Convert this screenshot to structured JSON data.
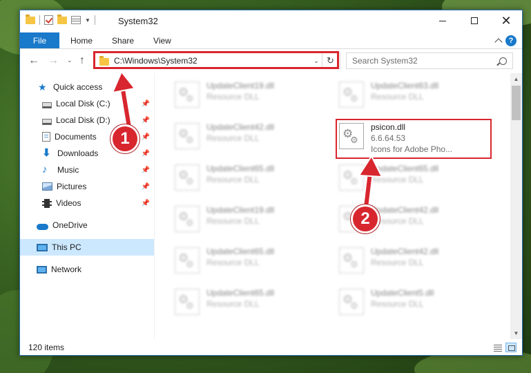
{
  "window": {
    "title": "System32"
  },
  "ribbon": {
    "tabs": [
      "File",
      "Home",
      "Share",
      "View"
    ]
  },
  "address": {
    "path": "C:\\Windows\\System32"
  },
  "search": {
    "placeholder": "Search System32"
  },
  "sidebar": {
    "items": [
      {
        "label": "Quick access",
        "icon": "star-icon",
        "pinned": false
      },
      {
        "label": "Local Disk (C:)",
        "icon": "drive-icon",
        "pinned": true
      },
      {
        "label": "Local Disk (D:)",
        "icon": "drive-icon",
        "pinned": true
      },
      {
        "label": "Documents",
        "icon": "documents-icon",
        "pinned": true
      },
      {
        "label": "Downloads",
        "icon": "download-arrow-icon",
        "pinned": true
      },
      {
        "label": "Music",
        "icon": "music-note-icon",
        "pinned": true
      },
      {
        "label": "Pictures",
        "icon": "picture-icon",
        "pinned": true
      },
      {
        "label": "Videos",
        "icon": "film-icon",
        "pinned": true
      },
      {
        "label": "OneDrive",
        "icon": "cloud-icon",
        "pinned": false
      },
      {
        "label": "This PC",
        "icon": "computer-icon",
        "pinned": false,
        "selected": true
      },
      {
        "label": "Network",
        "icon": "network-icon",
        "pinned": false
      }
    ]
  },
  "files": [
    {
      "name": "UpdateClient19.dll",
      "desc": "Resource DLL",
      "blurred": true
    },
    {
      "name": "UpdateClient63.dll",
      "desc": "Resource DLL",
      "blurred": true
    },
    {
      "name": "UpdateClient42.dll",
      "desc": "Resource DLL",
      "blurred": true
    },
    {
      "name": "psicon.dll",
      "version": "6.6.64.53",
      "desc": "Icons for Adobe Pho...",
      "blurred": false,
      "highlighted": true
    },
    {
      "name": "UpdateClient65.dll",
      "desc": "Resource DLL",
      "blurred": true
    },
    {
      "name": "UpdateClient65.dll",
      "desc": "Resource DLL",
      "blurred": true
    },
    {
      "name": "UpdateClient19.dll",
      "desc": "Resource DLL",
      "blurred": true
    },
    {
      "name": "UpdateClient42.dll",
      "desc": "Resource DLL",
      "blurred": true
    },
    {
      "name": "UpdateClient65.dll",
      "desc": "Resource DLL",
      "blurred": true
    },
    {
      "name": "UpdateClient42.dll",
      "desc": "Resource DLL",
      "blurred": true
    },
    {
      "name": "UpdateClient65.dll",
      "desc": "Resource DLL",
      "blurred": true
    },
    {
      "name": "UpdateClient5.dll",
      "desc": "Resource DLL",
      "blurred": true
    }
  ],
  "status": {
    "item_count": "120 items"
  },
  "annotations": [
    {
      "number": "1"
    },
    {
      "number": "2"
    }
  ],
  "colors": {
    "accent": "#1979ca",
    "annotation": "#d8262e",
    "selected": "#cce8ff"
  }
}
